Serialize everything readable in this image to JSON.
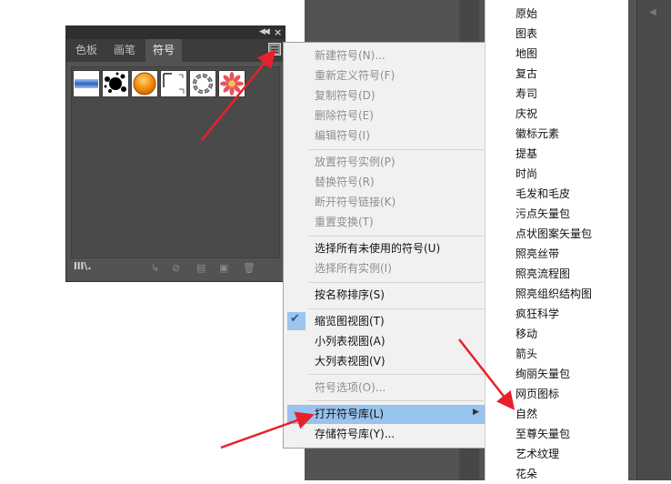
{
  "panel": {
    "tabs": [
      "色板",
      "画笔",
      "符号"
    ],
    "active_tab": "符号"
  },
  "symbols": [
    {
      "name": "blue-gradient-bar-symbol"
    },
    {
      "name": "ink-splat-symbol"
    },
    {
      "name": "orange-button-symbol"
    },
    {
      "name": "corner-marks-symbol"
    },
    {
      "name": "chain-ring-symbol"
    },
    {
      "name": "red-flower-symbol"
    }
  ],
  "menu": {
    "items": [
      {
        "label": "新建符号(N)...",
        "enabled": false
      },
      {
        "label": "重新定义符号(F)",
        "enabled": false
      },
      {
        "label": "复制符号(D)",
        "enabled": false
      },
      {
        "label": "删除符号(E)",
        "enabled": false
      },
      {
        "label": "编辑符号(I)",
        "enabled": false
      },
      {
        "label": "放置符号实例(P)",
        "enabled": false
      },
      {
        "label": "替换符号(R)",
        "enabled": false
      },
      {
        "label": "断开符号链接(K)",
        "enabled": false
      },
      {
        "label": "重置变换(T)",
        "enabled": false
      },
      {
        "label": "选择所有未使用的符号(U)",
        "enabled": true
      },
      {
        "label": "选择所有实例(I)",
        "enabled": false
      },
      {
        "label": "按名称排序(S)",
        "enabled": true
      },
      {
        "label": "缩览图视图(T)",
        "enabled": true,
        "checked": true
      },
      {
        "label": "小列表视图(A)",
        "enabled": true
      },
      {
        "label": "大列表视图(V)",
        "enabled": true
      },
      {
        "label": "符号选项(O)...",
        "enabled": false
      },
      {
        "label": "打开符号库(L)",
        "enabled": true,
        "highlighted": true
      },
      {
        "label": "存储符号库(Y)...",
        "enabled": true
      }
    ]
  },
  "library_list": [
    "原始",
    "图表",
    "地图",
    "复古",
    "寿司",
    "庆祝",
    "徽标元素",
    "提基",
    "时尚",
    "毛发和毛皮",
    "污点矢量包",
    "点状图案矢量包",
    "照亮丝带",
    "照亮流程图",
    "照亮组织结构图",
    "疯狂科学",
    "移动",
    "箭头",
    "绚丽矢量包",
    "网页图标",
    "自然",
    "至尊矢量包",
    "艺术纹理",
    "花朵"
  ],
  "colors": {
    "highlight": "#97c3ec",
    "annotation_arrow": "#e8202a",
    "panel_bg": "#535353"
  }
}
